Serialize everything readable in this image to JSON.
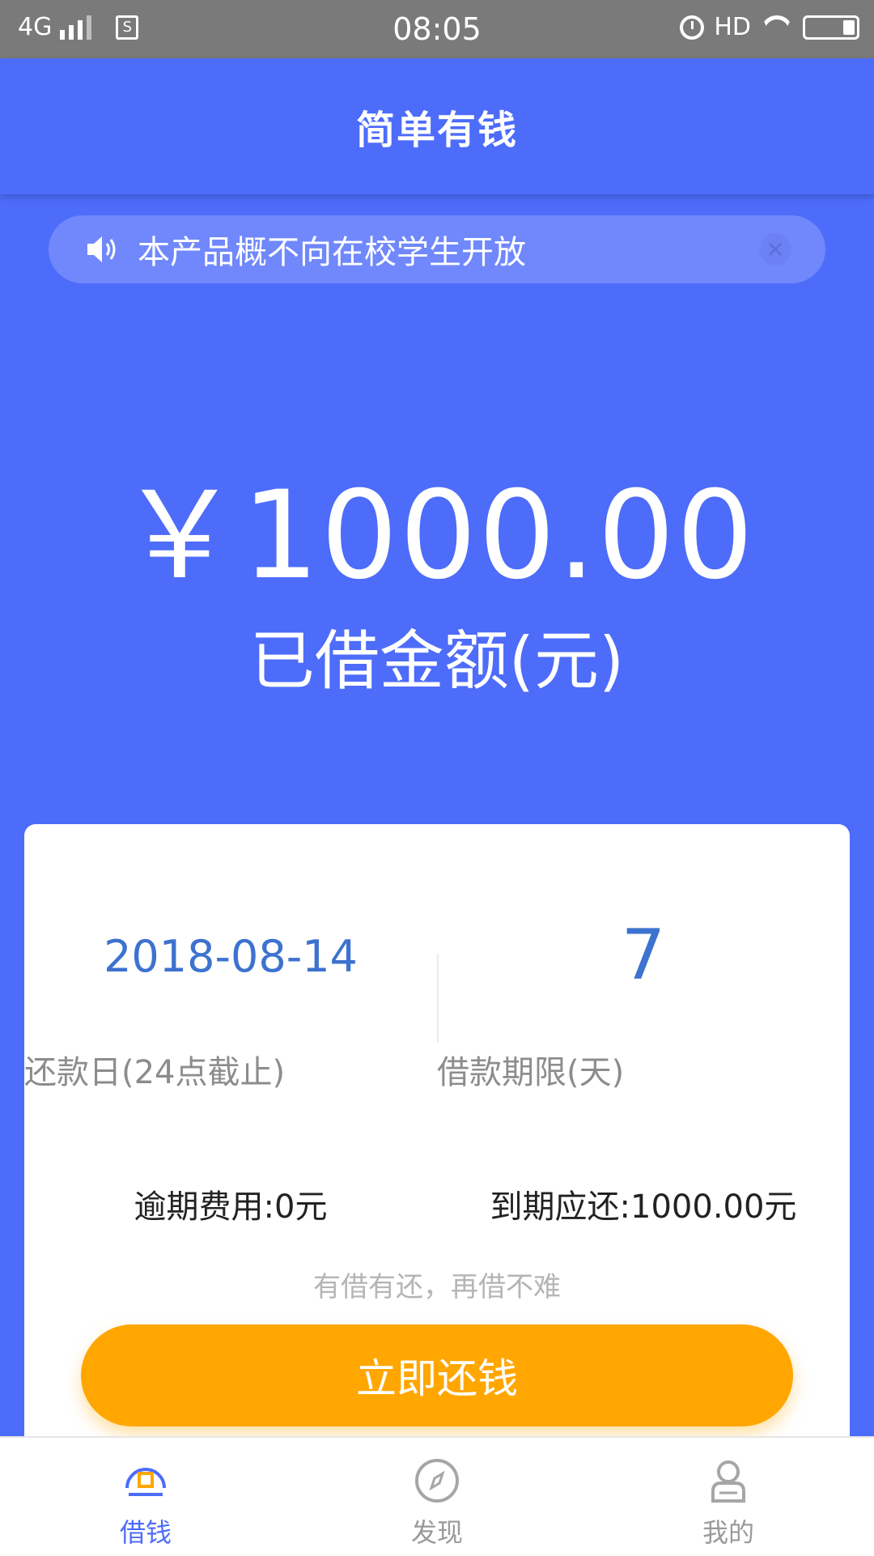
{
  "status_bar": {
    "network": "4G",
    "time": "08:05",
    "hd": "HD"
  },
  "header": {
    "title": "简单有钱"
  },
  "notice": {
    "text": "本产品概不向在校学生开放"
  },
  "loan": {
    "amount": "￥1000.00",
    "amount_label": "已借金额(元)"
  },
  "card": {
    "due_date": "2018-08-14",
    "due_date_label": "还款日(24点截止)",
    "term_days": "7",
    "term_label": "借款期限(天)",
    "overdue_fee": "逾期费用:0元",
    "due_amount": "到期应还:1000.00元",
    "slogan": "有借有还，再借不难",
    "repay_button": "立即还钱"
  },
  "tabs": [
    {
      "label": "借钱",
      "icon": "borrow-icon",
      "active": true
    },
    {
      "label": "发现",
      "icon": "compass-icon",
      "active": false
    },
    {
      "label": "我的",
      "icon": "user-icon",
      "active": false
    }
  ],
  "colors": {
    "primary": "#4d6cfa",
    "accent": "#ffa600",
    "value_blue": "#3d72cf"
  }
}
